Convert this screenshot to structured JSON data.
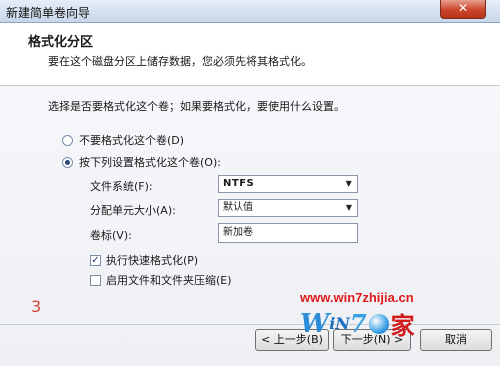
{
  "window": {
    "title": "新建简单卷向导",
    "close_glyph": "✕"
  },
  "header": {
    "title": "格式化分区",
    "description": "要在这个磁盘分区上储存数据，您必须先将其格式化。"
  },
  "main": {
    "question": "选择是否要格式化这个卷；如果要格式化，要使用什么设置。",
    "option_no_format": {
      "label": "不要格式化这个卷(D)",
      "selected": false
    },
    "option_format": {
      "label": "按下列设置格式化这个卷(O):",
      "selected": true
    },
    "file_system": {
      "label": "文件系统(F):",
      "value": "NTFS"
    },
    "allocation_unit": {
      "label": "分配单元大小(A):",
      "value": "默认值"
    },
    "volume_label": {
      "label": "卷标(V):",
      "value": "新加卷"
    },
    "quick_format": {
      "label": "执行快速格式化(P)",
      "checked": true
    },
    "compression": {
      "label": "启用文件和文件夹压缩(E)",
      "checked": false
    },
    "page_number": "3"
  },
  "buttons": {
    "back": "< 上一步(B)",
    "next": "下一步(N) >",
    "cancel": "取消"
  },
  "watermark": {
    "url": "www.win7zhijia.cn",
    "logo_w": "W",
    "logo_in": "iN",
    "logo_7": "7",
    "logo_home": "家"
  },
  "icons": {
    "dropdown": "chevron-down-icon",
    "check": "checkmark-icon"
  },
  "colors": {
    "accent": "#2a4a7a",
    "watermark_red": "#e01a1a",
    "close_red": "#c9452b"
  }
}
